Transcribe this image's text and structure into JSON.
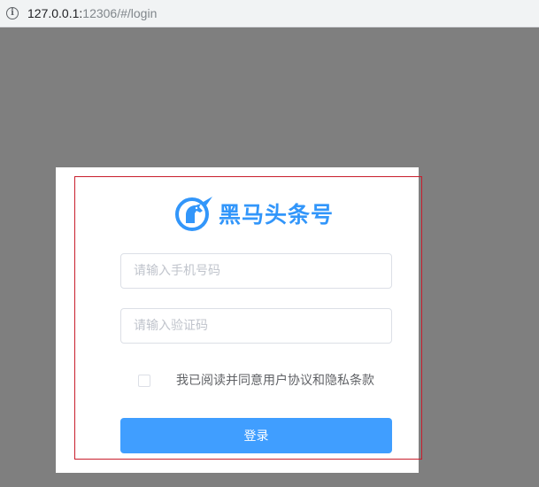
{
  "browser": {
    "url_host": "127.0.0.1:",
    "url_rest": "12306/#/login",
    "info_icon": "info-icon"
  },
  "login": {
    "logo_icon": "horse-head-icon",
    "brand_name": "黑马头条号",
    "brand_color": "#3296fa",
    "phone_placeholder": "请输入手机号码",
    "phone_value": "",
    "code_placeholder": "请输入验证码",
    "code_value": "",
    "agreement_checked": false,
    "agreement_text": "我已阅读并同意用户协议和隐私条款",
    "submit_label": "登录",
    "button_color": "#409eff"
  }
}
